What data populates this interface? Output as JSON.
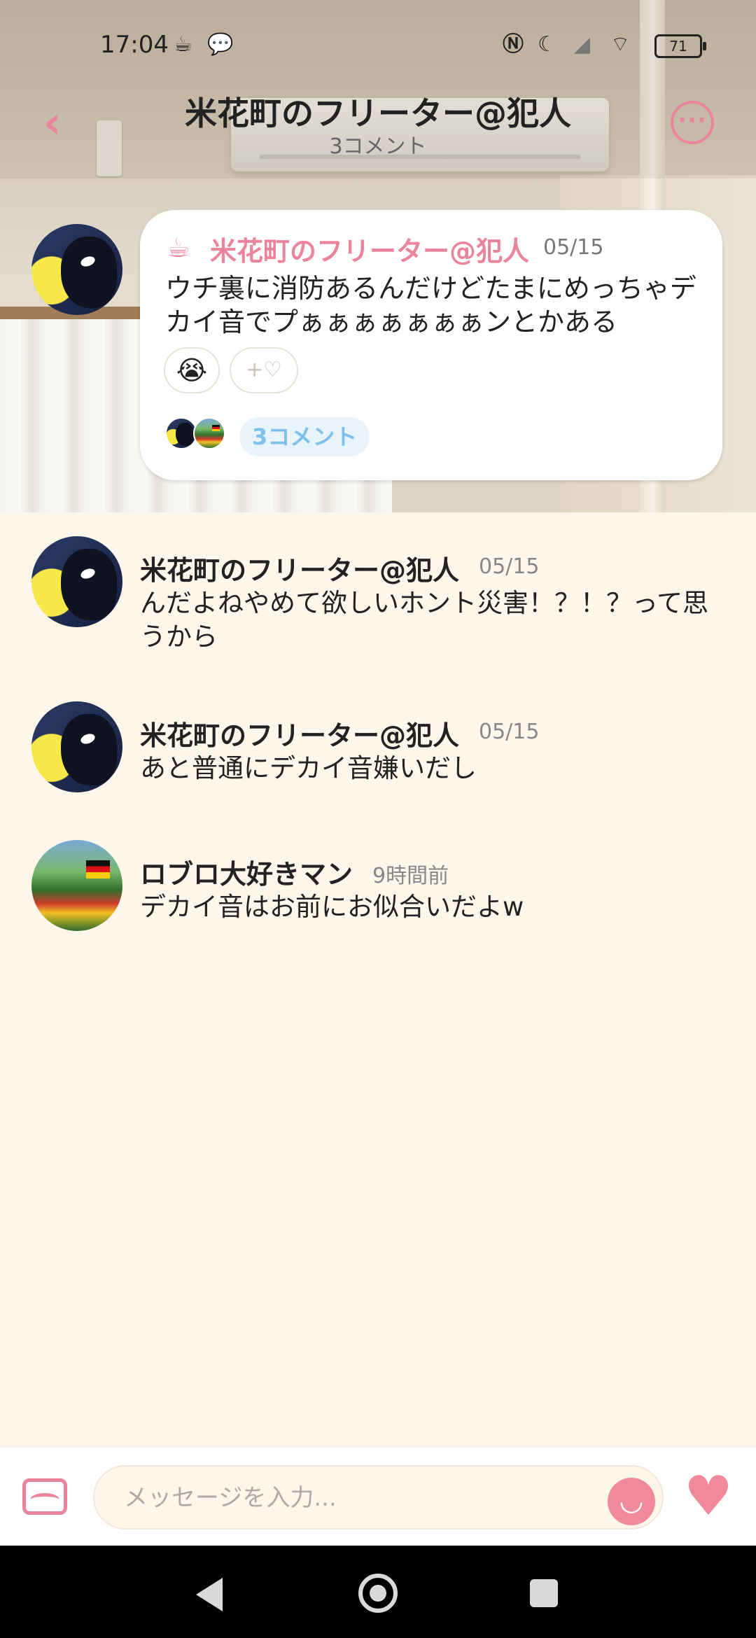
{
  "status_bar": {
    "time": "17:04",
    "battery": "71",
    "icons": [
      "cup-icon",
      "chat-bubble-icon",
      "nfc-icon",
      "moon-icon",
      "signal-icon",
      "wifi-icon",
      "battery-icon"
    ]
  },
  "header": {
    "title": "米花町のフリーター@犯人",
    "subtitle": "3コメント"
  },
  "post": {
    "author": "米花町のフリーター@犯人",
    "date": "05/15",
    "text": "ウチ裏に消防あるんだけどたまにめっちゃデカイ音でプぁぁぁぁぁぁぁンとかある",
    "reaction_emoji": "😭",
    "add_reaction_label": "+♡",
    "comment_count_label": "3コメント"
  },
  "comments": [
    {
      "author": "米花町のフリーター@犯人",
      "time": "05/15",
      "text": "んだよねやめて欲しいホント災害！？！？って思うから"
    },
    {
      "author": "米花町のフリーター@犯人",
      "time": "05/15",
      "text": "あと普通にデカイ音嫌いだし"
    },
    {
      "author": "ロブロ大好きマン",
      "time": "9時間前",
      "text": "デカイ音はお前にお似合いだよw"
    }
  ],
  "input": {
    "placeholder": "メッセージを入力..."
  },
  "colors": {
    "accent": "#e9849c",
    "background": "#fdf6ea",
    "comment_pill_bg": "#e8f3fb",
    "comment_pill_text": "#7ec0ea"
  }
}
